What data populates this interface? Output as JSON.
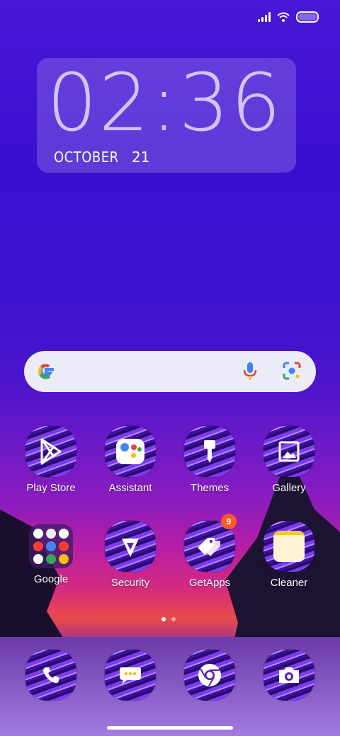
{
  "status_bar": {
    "icons": [
      "signal-icon",
      "wifi-icon",
      "battery-icon"
    ]
  },
  "clock_widget": {
    "time": "02:36",
    "month": "OCTOBER",
    "day": "21"
  },
  "search_bar": {
    "icons": [
      "google-g-icon",
      "microphone-icon",
      "lens-icon"
    ]
  },
  "apps": [
    {
      "label": "Play Store",
      "icon": "play-store-icon"
    },
    {
      "label": "Assistant",
      "icon": "assistant-icon"
    },
    {
      "label": "Themes",
      "icon": "paintbrush-icon"
    },
    {
      "label": "Gallery",
      "icon": "gallery-icon"
    },
    {
      "label": "Google",
      "icon": "folder-icon"
    },
    {
      "label": "Security",
      "icon": "security-icon"
    },
    {
      "label": "GetApps",
      "icon": "tags-icon",
      "badge": "9"
    },
    {
      "label": "Cleaner",
      "icon": "cleaner-icon"
    }
  ],
  "dock": [
    {
      "icon": "phone-icon"
    },
    {
      "icon": "messages-icon"
    },
    {
      "icon": "chrome-icon"
    },
    {
      "icon": "camera-icon"
    }
  ],
  "page_indicator": {
    "current": 1,
    "total": 2
  }
}
